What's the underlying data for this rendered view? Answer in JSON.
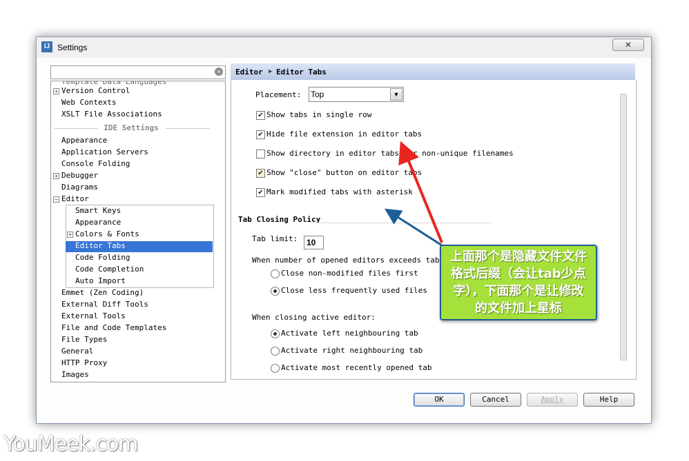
{
  "window": {
    "title": "Settings",
    "close_glyph": "✕",
    "app_icon": "intellij-icon",
    "app_icon_text": "IJ"
  },
  "search": {
    "value": "",
    "clear_glyph": "×"
  },
  "tree": {
    "partial_top": "Template Data Languages",
    "items_a": [
      {
        "label": "Version Control",
        "expand": "+"
      },
      {
        "label": "Web Contexts"
      },
      {
        "label": "XSLT File Associations"
      }
    ],
    "section": "IDE Settings",
    "items_b": [
      {
        "label": "Appearance"
      },
      {
        "label": "Application Servers"
      },
      {
        "label": "Console Folding"
      },
      {
        "label": "Debugger",
        "expand": "+"
      },
      {
        "label": "Diagrams"
      },
      {
        "label": "Editor",
        "expand": "−"
      }
    ],
    "editor_children": [
      {
        "label": "Smart Keys"
      },
      {
        "label": "Appearance"
      },
      {
        "label": "Colors & Fonts",
        "expand": "+"
      },
      {
        "label": "Editor Tabs",
        "selected": true
      },
      {
        "label": "Code Folding"
      },
      {
        "label": "Code Completion"
      },
      {
        "label": "Auto Import"
      }
    ],
    "items_c": [
      {
        "label": "Emmet (Zen Coding)"
      },
      {
        "label": "External Diff Tools"
      },
      {
        "label": "External Tools"
      },
      {
        "label": "File and Code Templates"
      },
      {
        "label": "File Types"
      },
      {
        "label": "General"
      },
      {
        "label": "HTTP Proxy"
      },
      {
        "label": "Images"
      }
    ]
  },
  "breadcrumb": {
    "part1": "Editor",
    "sep": "▶",
    "part2": "Editor Tabs"
  },
  "editor_tabs": {
    "placement_label": "Placement:",
    "placement_value": "Top",
    "checkboxes": [
      {
        "label": "Show tabs in single row",
        "checked": true
      },
      {
        "label": "Hide file extension in editor tabs",
        "checked": true
      },
      {
        "label": "Show directory in editor tabs for non-unique filenames",
        "checked": false
      },
      {
        "label": "Show \"close\" button on editor tabs",
        "checked": true
      },
      {
        "label": "Mark modified tabs with asterisk",
        "checked": true
      }
    ],
    "closing_policy_title": "Tab Closing Policy",
    "tab_limit_label": "Tab limit:",
    "tab_limit_value": "10",
    "exceeds_label": "When number of opened editors exceeds tab limit:",
    "exceeds_options": [
      {
        "label": "Close non-modified files first",
        "selected": false
      },
      {
        "label": "Close less frequently used files",
        "selected": true
      }
    ],
    "closing_label": "When closing active editor:",
    "closing_options": [
      {
        "label": "Activate left neighbouring tab",
        "selected": true
      },
      {
        "label": "Activate right neighbouring tab",
        "selected": false
      },
      {
        "label": "Activate most recently opened tab",
        "selected": false
      }
    ]
  },
  "buttons": {
    "ok": "OK",
    "cancel": "Cancel",
    "apply": "Apply",
    "help": "Help"
  },
  "annotation": {
    "lines": [
      "上面那个是隐藏文件文件",
      "格式后缀（会让tab少点",
      "字），下面那个是让修改",
      "的文件加上星标"
    ],
    "color": "#a6e03a",
    "arrow_red": "#e8261f",
    "arrow_blue": "#1d5e96"
  },
  "watermark": "YouMeek.com"
}
